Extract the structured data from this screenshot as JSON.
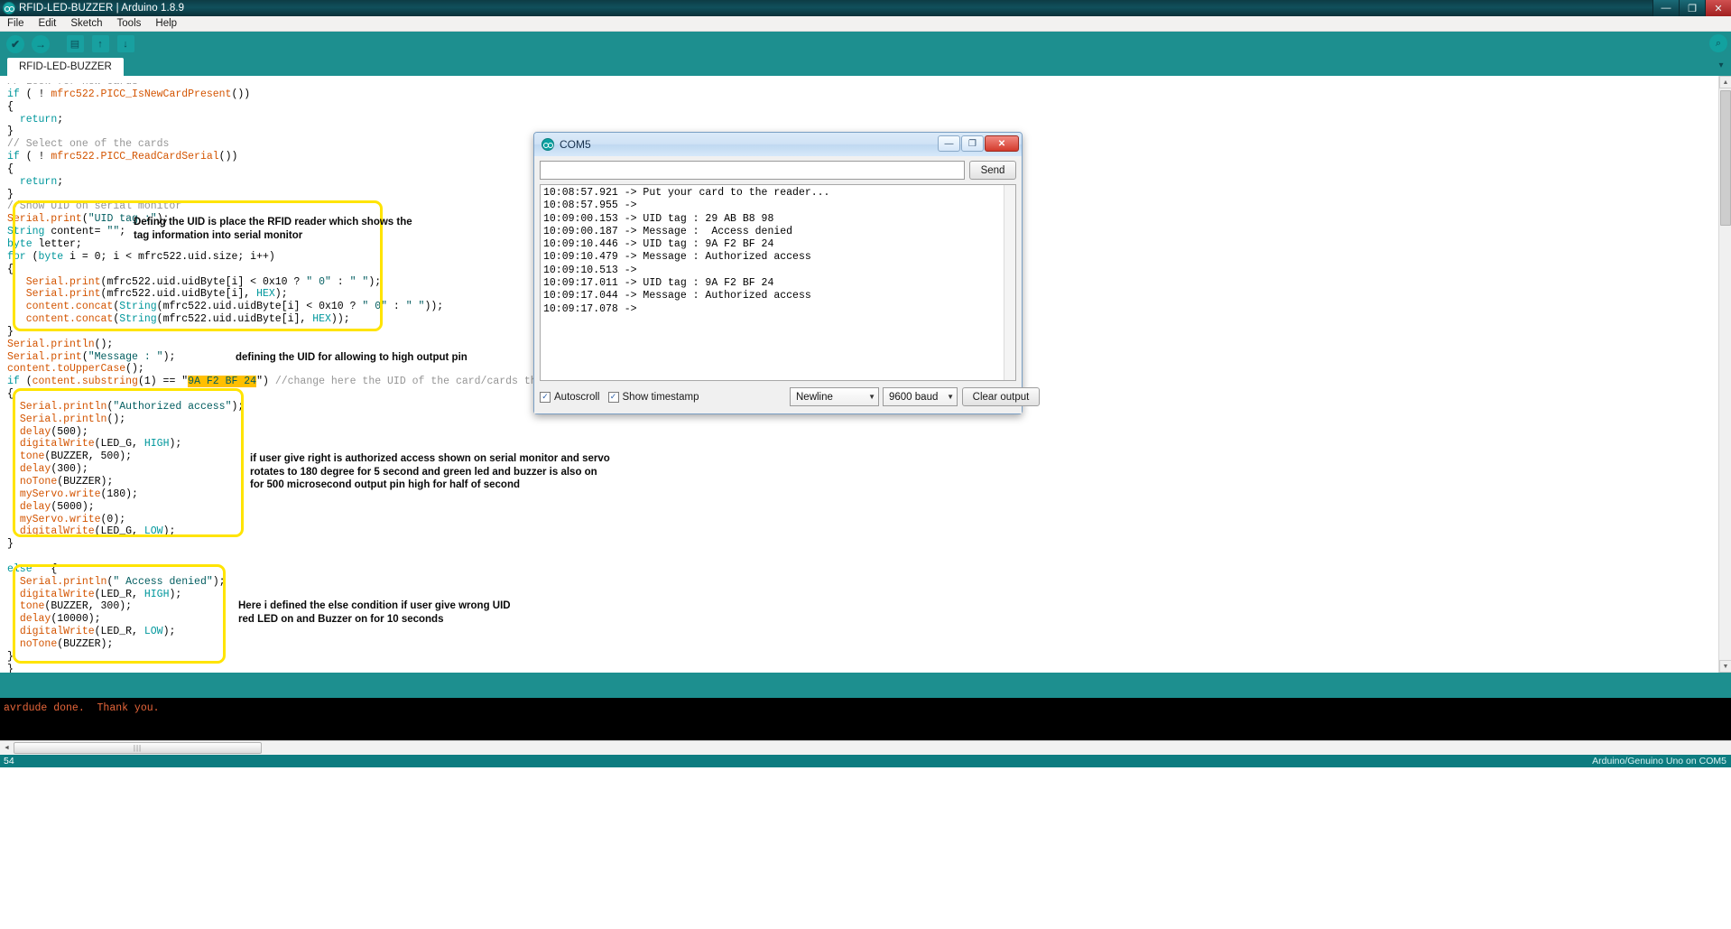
{
  "window": {
    "title": "RFID-LED-BUZZER | Arduino 1.8.9",
    "minimize": "—",
    "maximize": "❐",
    "close": "✕"
  },
  "menubar": {
    "items": [
      "File",
      "Edit",
      "Sketch",
      "Tools",
      "Help"
    ]
  },
  "toolbar": {
    "verify": "✔",
    "upload": "→",
    "new_sketch": "▤",
    "open": "↑",
    "save": "↓",
    "serial_monitor": "⌕"
  },
  "tabs": {
    "active": "RFID-LED-BUZZER",
    "overflow_icon": "▾"
  },
  "editor": {
    "lines": [
      {
        "text": "// Look for new cards",
        "cls": "cmt",
        "clipped": true
      },
      {
        "text": "if ( ! mfrc522.PICC_IsNewCardPresent())"
      },
      {
        "text": "{"
      },
      {
        "text": "  return;"
      },
      {
        "text": "}"
      },
      {
        "text": "// Select one of the cards",
        "cls": "cmt"
      },
      {
        "text": "if ( ! mfrc522.PICC_ReadCardSerial())"
      },
      {
        "text": "{"
      },
      {
        "text": "  return;"
      },
      {
        "text": "}"
      },
      {
        "text": "//Show UID on serial monitor",
        "cls": "cmt"
      },
      {
        "text": "Serial.print(\"UID tag :\");"
      },
      {
        "text": "String content= \"\";"
      },
      {
        "text": "byte letter;"
      },
      {
        "text": "for (byte i = 0; i < mfrc522.uid.size; i++)"
      },
      {
        "text": "{"
      },
      {
        "text": "   Serial.print(mfrc522.uid.uidByte[i] < 0x10 ? \" 0\" : \" \");"
      },
      {
        "text": "   Serial.print(mfrc522.uid.uidByte[i], HEX);"
      },
      {
        "text": "   content.concat(String(mfrc522.uid.uidByte[i] < 0x10 ? \" 0\" : \" \"));"
      },
      {
        "text": "   content.concat(String(mfrc522.uid.uidByte[i], HEX));"
      },
      {
        "text": "}"
      },
      {
        "text": "Serial.println();"
      },
      {
        "text": "Serial.print(\"Message : \");"
      },
      {
        "text": "content.toUpperCase();"
      },
      {
        "text": "if (content.substring(1) == \"9A F2 BF 24\") //change here the UID of the card/cards that you want to g"
      },
      {
        "text": "{"
      },
      {
        "text": "  Serial.println(\"Authorized access\");"
      },
      {
        "text": "  Serial.println();"
      },
      {
        "text": "  delay(500);"
      },
      {
        "text": "  digitalWrite(LED_G, HIGH);"
      },
      {
        "text": "  tone(BUZZER, 500);"
      },
      {
        "text": "  delay(300);"
      },
      {
        "text": "  noTone(BUZZER);"
      },
      {
        "text": "  myServo.write(180);"
      },
      {
        "text": "  delay(5000);"
      },
      {
        "text": "  myServo.write(0);"
      },
      {
        "text": "  digitalWrite(LED_G, LOW);"
      },
      {
        "text": "}"
      },
      {
        "text": ""
      },
      {
        "text": "else   {"
      },
      {
        "text": "  Serial.println(\" Access denied\");"
      },
      {
        "text": "  digitalWrite(LED_R, HIGH);"
      },
      {
        "text": "  tone(BUZZER, 300);"
      },
      {
        "text": "  delay(10000);"
      },
      {
        "text": "  digitalWrite(LED_R, LOW);"
      },
      {
        "text": "  noTone(BUZZER);"
      },
      {
        "text": "}"
      },
      {
        "text": "}"
      }
    ],
    "highlighted_uid": "9A F2 BF 24"
  },
  "annotations": [
    {
      "id": "note1",
      "text": "Defing the UID is place the RFID reader which shows the\ntag information into serial monitor"
    },
    {
      "id": "note2",
      "text": "defining the UID  for allowing to high output pin"
    },
    {
      "id": "note3",
      "text": "if user give right is authorized access shown on serial monitor and servo\nrotates to 180 degree for 5 second and green led and buzzer is also on\nfor 500 microsecond output pin high for half of second"
    },
    {
      "id": "note4",
      "text": "Here i defined the else condition if user give wrong UID\nred LED on and Buzzer on for 10 seconds"
    }
  ],
  "serial_monitor": {
    "title": "COM5",
    "minimize": "—",
    "maximize": "❐",
    "close": "✕",
    "input_value": "",
    "input_placeholder": "",
    "send_label": "Send",
    "output_lines": [
      "10:08:57.921 -> Put your card to the reader...",
      "10:08:57.955 ->",
      "10:09:00.153 -> UID tag : 29 AB B8 98",
      "10:09:00.187 -> Message :  Access denied",
      "10:09:10.446 -> UID tag : 9A F2 BF 24",
      "10:09:10.479 -> Message : Authorized access",
      "10:09:10.513 ->",
      "10:09:17.011 -> UID tag : 9A F2 BF 24",
      "10:09:17.044 -> Message : Authorized access",
      "10:09:17.078 ->"
    ],
    "autoscroll_label": "Autoscroll",
    "autoscroll_checked": "✓",
    "timestamp_label": "Show timestamp",
    "timestamp_checked": "✓",
    "line_ending": "Newline",
    "baud_rate": "9600 baud",
    "clear_label": "Clear output",
    "caret": "▼"
  },
  "console": {
    "text": "avrdude done.  Thank you."
  },
  "bottom": {
    "line_number": "54",
    "board_info": "Arduino/Genuino Uno on COM5",
    "hscroll_grip": "|||",
    "scroll_left": "◄"
  },
  "colors": {
    "teal": "#1d8f8f",
    "dark_teal": "#066e73",
    "highlight": "#ffbf00",
    "annotation_border": "#ffe400",
    "console_text": "#e8663a"
  }
}
